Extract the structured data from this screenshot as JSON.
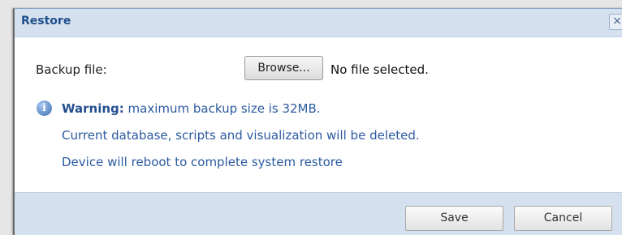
{
  "dialog": {
    "title": "Restore",
    "close_glyph": "×"
  },
  "form": {
    "backup_label": "Backup file:",
    "browse_label": "Browse...",
    "file_status": "No file selected."
  },
  "info": {
    "icon": "info-icon",
    "icon_glyph": "i",
    "warning_prefix": "Warning:",
    "warning_text": " maximum backup size is 32MB.",
    "line2": "Current database, scripts and visualization will be deleted.",
    "line3": "Device will reboot to complete system restore"
  },
  "footer": {
    "save_label": "Save",
    "cancel_label": "Cancel"
  },
  "colors": {
    "titlebar_bg": "#d6e1ef",
    "title_text": "#1d4f8c",
    "info_text": "#2c5aa0"
  }
}
